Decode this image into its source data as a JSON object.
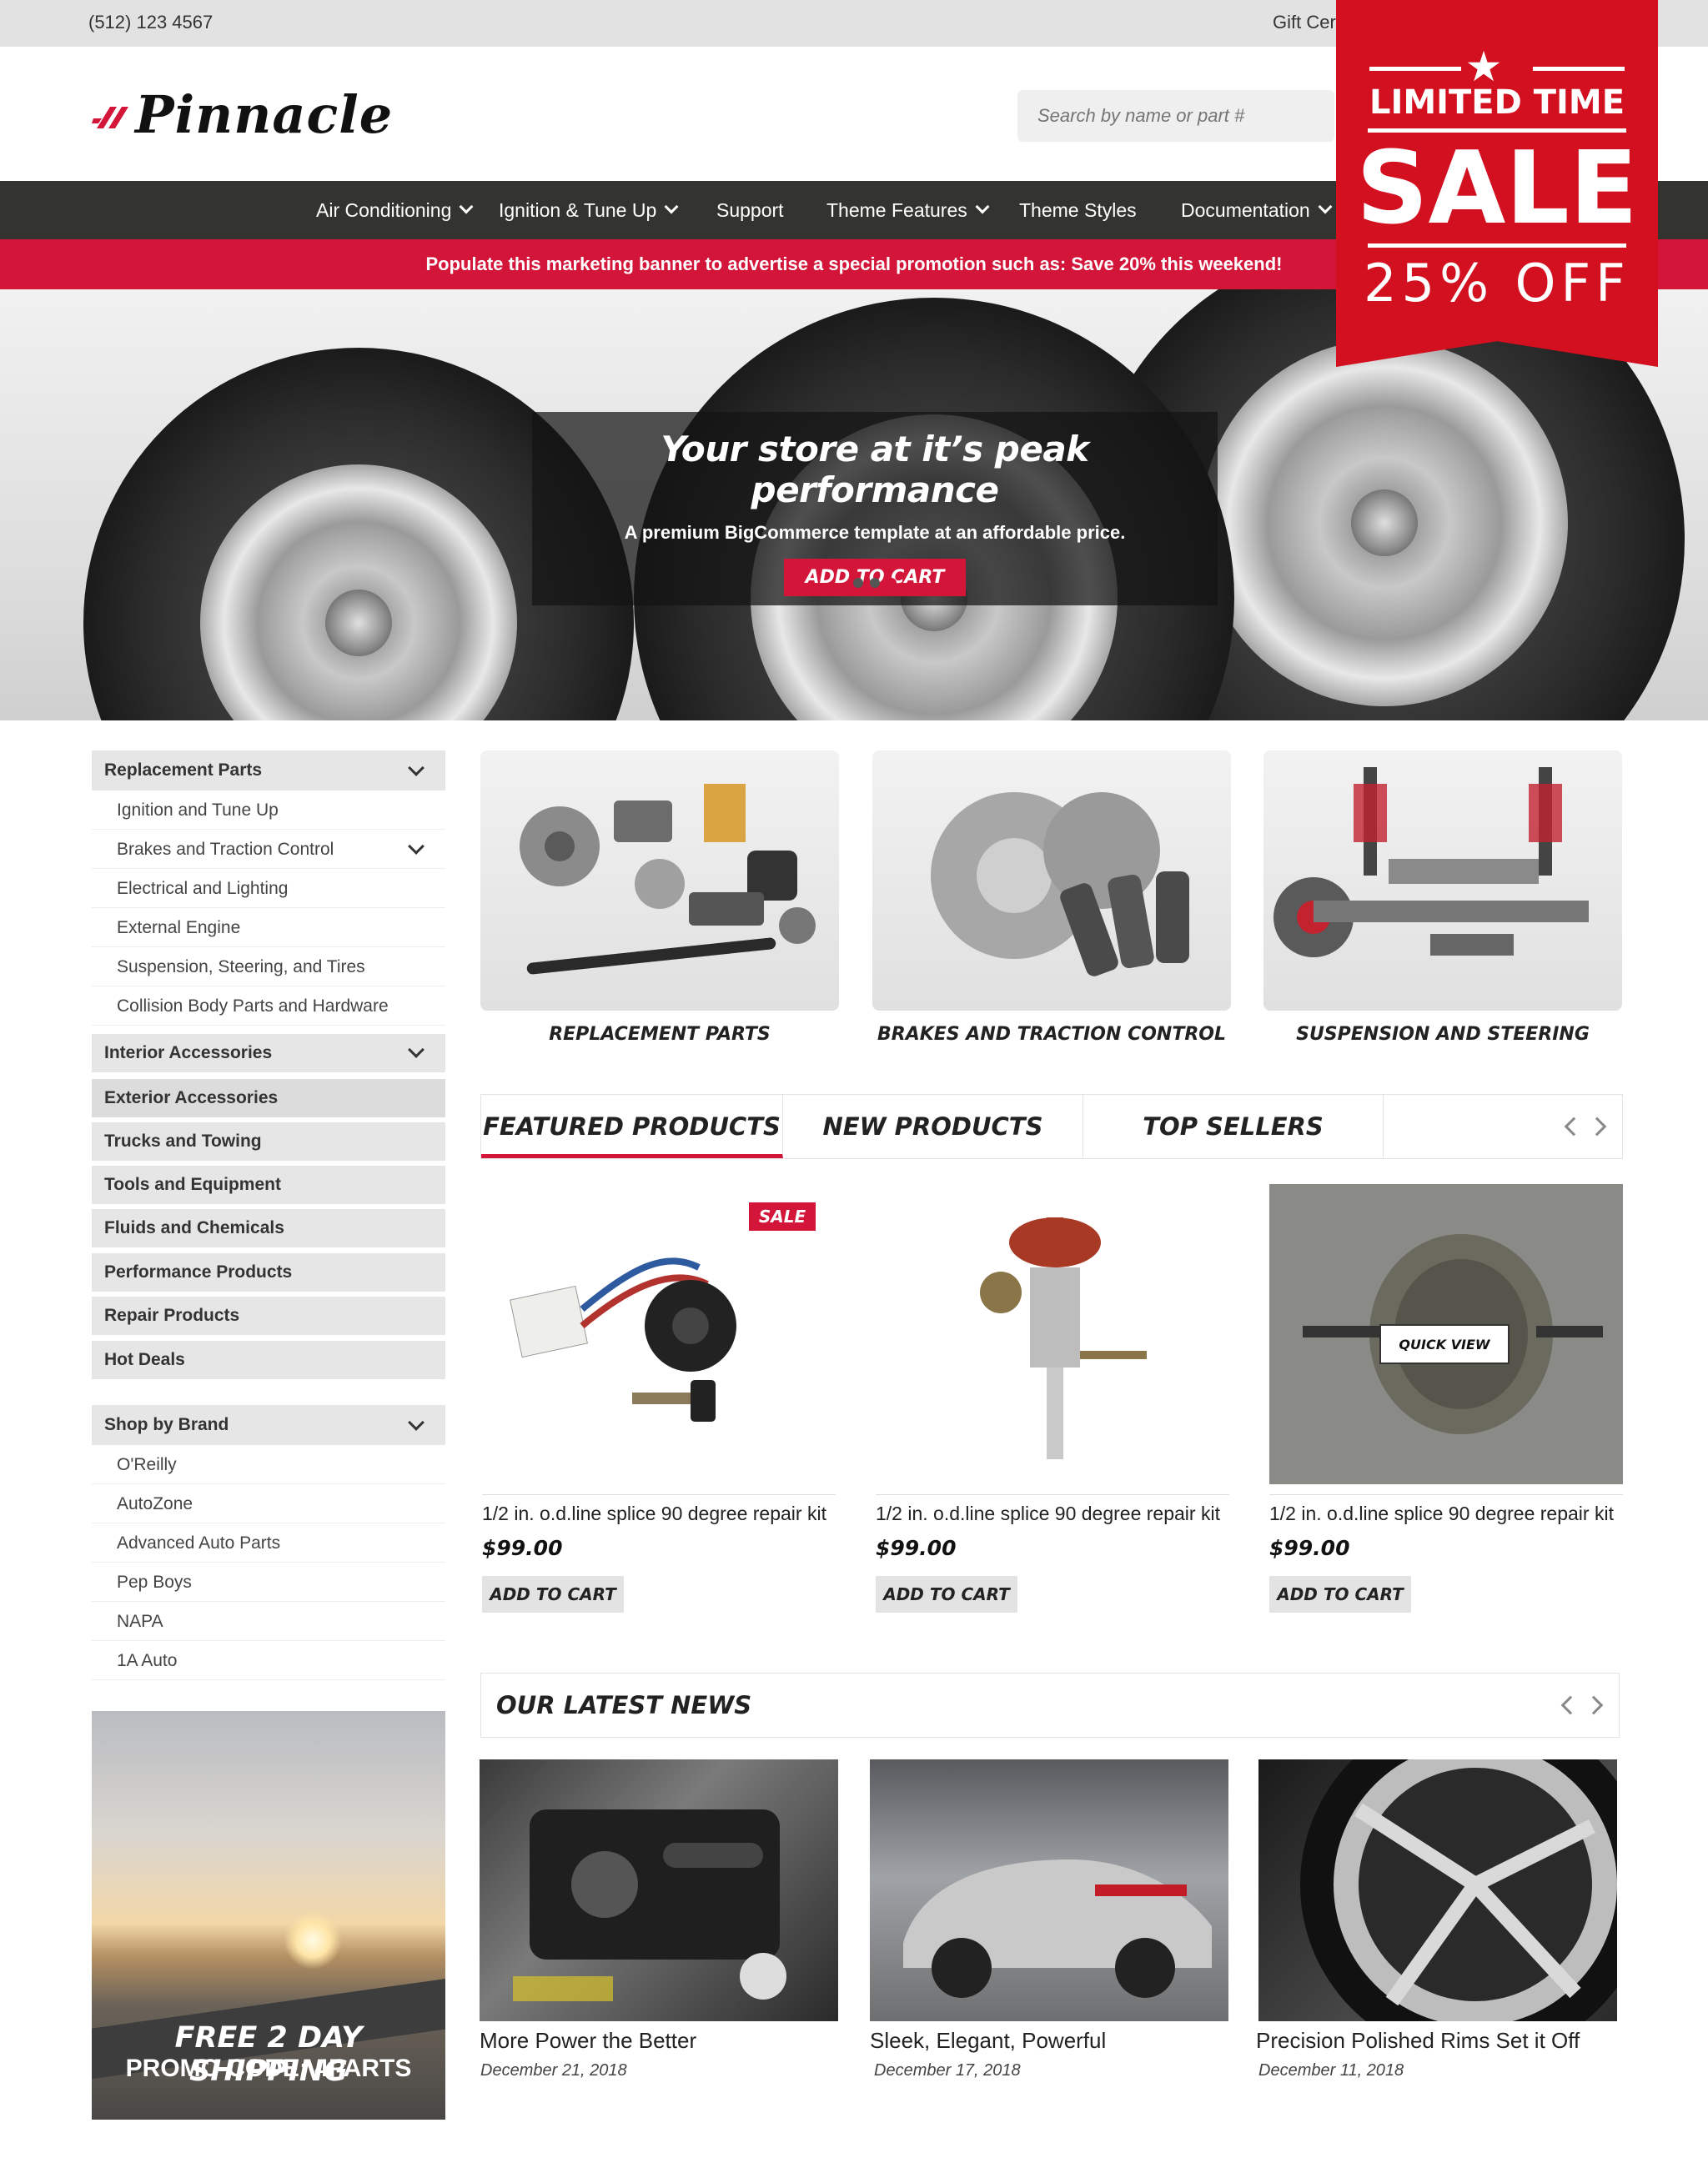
{
  "topbar": {
    "phone": "(512) 123 4567",
    "gift": "Gift Cer"
  },
  "header": {
    "logo": "Pinnacle",
    "search_placeholder": "Search by name or part #"
  },
  "nav": [
    "Air Conditioning",
    "Ignition & Tune Up",
    "Support",
    "Theme Features",
    "Theme Styles",
    "Documentation"
  ],
  "promo_banner": "Populate this marketing banner to advertise a special promotion such as: Save 20% this weekend!",
  "hero": {
    "title": "Your store at it’s peak performance",
    "subtitle": "A premium BigCommerce template at an affordable price.",
    "button": "ADD TO CART"
  },
  "sale_badge": {
    "line1": "LIMITED TIME",
    "line2": "SALE",
    "line3": "25% OFF"
  },
  "sidebar": {
    "replacement": {
      "title": "Replacement Parts",
      "items": [
        "Ignition and Tune Up",
        "Brakes and Traction Control",
        "Electrical and Lighting",
        "External Engine",
        "Suspension, Steering, and Tires",
        "Collision Body Parts and Hardware"
      ]
    },
    "categories": [
      "Interior Accessories",
      "Exterior Accessories",
      "Trucks and Towing",
      "Tools and Equipment",
      "Fluids and Chemicals",
      "Performance Products",
      "Repair Products",
      "Hot Deals"
    ],
    "brands": {
      "title": "Shop by Brand",
      "items": [
        "O'Reilly",
        "AutoZone",
        "Advanced Auto Parts",
        "Pep Boys",
        "NAPA",
        "1A Auto"
      ]
    }
  },
  "shipping_promo": {
    "line1": "FREE 2 DAY SHIPPING",
    "line2": "PROMO CODE: 4PARTS"
  },
  "category_tiles": [
    "REPLACEMENT PARTS",
    "BRAKES AND TRACTION CONTROL",
    "SUSPENSION AND STEERING"
  ],
  "tabs": [
    "FEATURED PRODUCTS",
    "NEW PRODUCTS",
    "TOP SELLERS"
  ],
  "products": {
    "sale_tag": "SALE",
    "quick_view": "QUICK VIEW",
    "items": [
      {
        "name": "1/2 in. o.d.line splice 90 degree repair kit",
        "price": "$99.00",
        "button": "ADD TO CART"
      },
      {
        "name": "1/2 in. o.d.line splice 90 degree repair kit",
        "price": "$99.00",
        "button": "ADD TO CART"
      },
      {
        "name": "1/2 in. o.d.line splice 90 degree repair kit",
        "price": "$99.00",
        "button": "ADD TO CART"
      }
    ]
  },
  "news": {
    "title": "OUR LATEST NEWS",
    "items": [
      {
        "title": "More Power the Better",
        "date": "December 21, 2018"
      },
      {
        "title": "Sleek, Elegant, Powerful",
        "date": "December 17, 2018"
      },
      {
        "title": "Precision Polished Rims Set it Off",
        "date": "December 11, 2018"
      }
    ]
  },
  "colors": {
    "accent": "#d4153a",
    "nav_bg": "#333330",
    "badge_red": "#d2101f"
  }
}
